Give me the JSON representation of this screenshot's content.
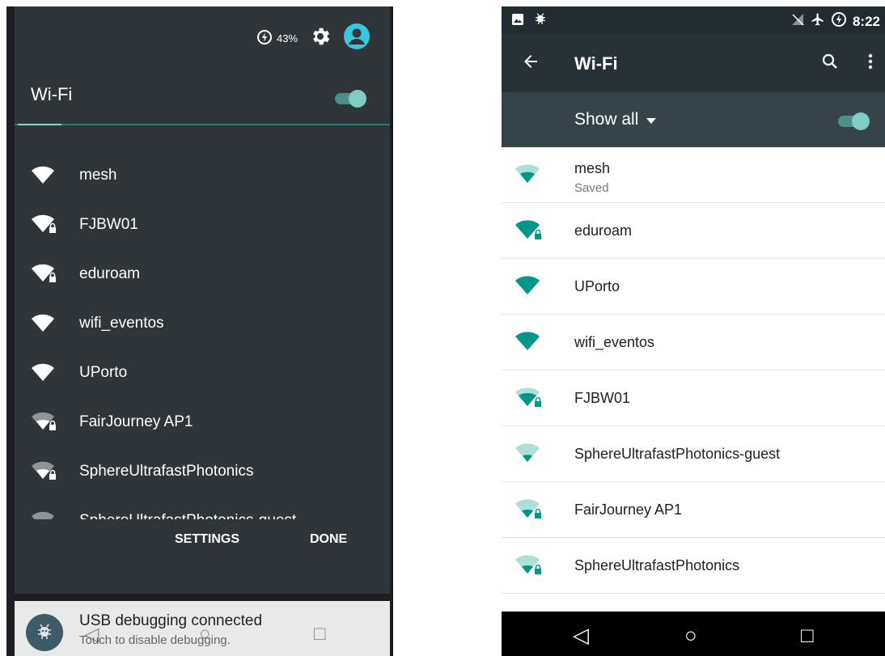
{
  "left": {
    "battery_percent": "43%",
    "panel_title": "Wi-Fi",
    "wifi_enabled": true,
    "networks": [
      {
        "name": "mesh",
        "icon": "wifi-full-icon"
      },
      {
        "name": "FJBW01",
        "icon": "wifi-locked-icon"
      },
      {
        "name": "eduroam",
        "icon": "wifi-locked-icon"
      },
      {
        "name": "wifi_eventos",
        "icon": "wifi-full-icon"
      },
      {
        "name": "UPorto",
        "icon": "wifi-full-icon"
      },
      {
        "name": "FairJourney AP1",
        "icon": "wifi-weak-locked-icon"
      },
      {
        "name": "SphereUltrafastPhotonics",
        "icon": "wifi-weak-locked-icon"
      },
      {
        "name": "SphereUltrafastPhotonics-guest",
        "icon": "wifi-weak-icon"
      }
    ],
    "settings_label": "SETTINGS",
    "done_label": "DONE",
    "notification": {
      "title": "USB debugging connected",
      "text": "Touch to disable debugging."
    }
  },
  "right": {
    "status_time": "8:22",
    "title": "Wi-Fi",
    "filter_label": "Show all",
    "wifi_enabled": true,
    "networks": [
      {
        "name": "mesh",
        "status": "Saved",
        "icon": "wifi-full-icon"
      },
      {
        "name": "eduroam",
        "status": "",
        "icon": "wifi-locked-icon"
      },
      {
        "name": "UPorto",
        "status": "",
        "icon": "wifi-full-icon"
      },
      {
        "name": "wifi_eventos",
        "status": "",
        "icon": "wifi-full-icon"
      },
      {
        "name": "FJBW01",
        "status": "",
        "icon": "wifi-locked-icon"
      },
      {
        "name": "SphereUltrafastPhotonics-guest",
        "status": "",
        "icon": "wifi-weak-icon"
      },
      {
        "name": "FairJourney AP1",
        "status": "",
        "icon": "wifi-weak-locked-icon"
      },
      {
        "name": "SphereUltrafastPhotonics",
        "status": "",
        "icon": "wifi-weak-locked-icon"
      }
    ]
  },
  "colors": {
    "accent": "#009688",
    "toggle_thumb": "#80cbc4",
    "panel_bg": "#2f3539",
    "appbar_bg": "#273237",
    "subbar_bg": "#364349"
  }
}
